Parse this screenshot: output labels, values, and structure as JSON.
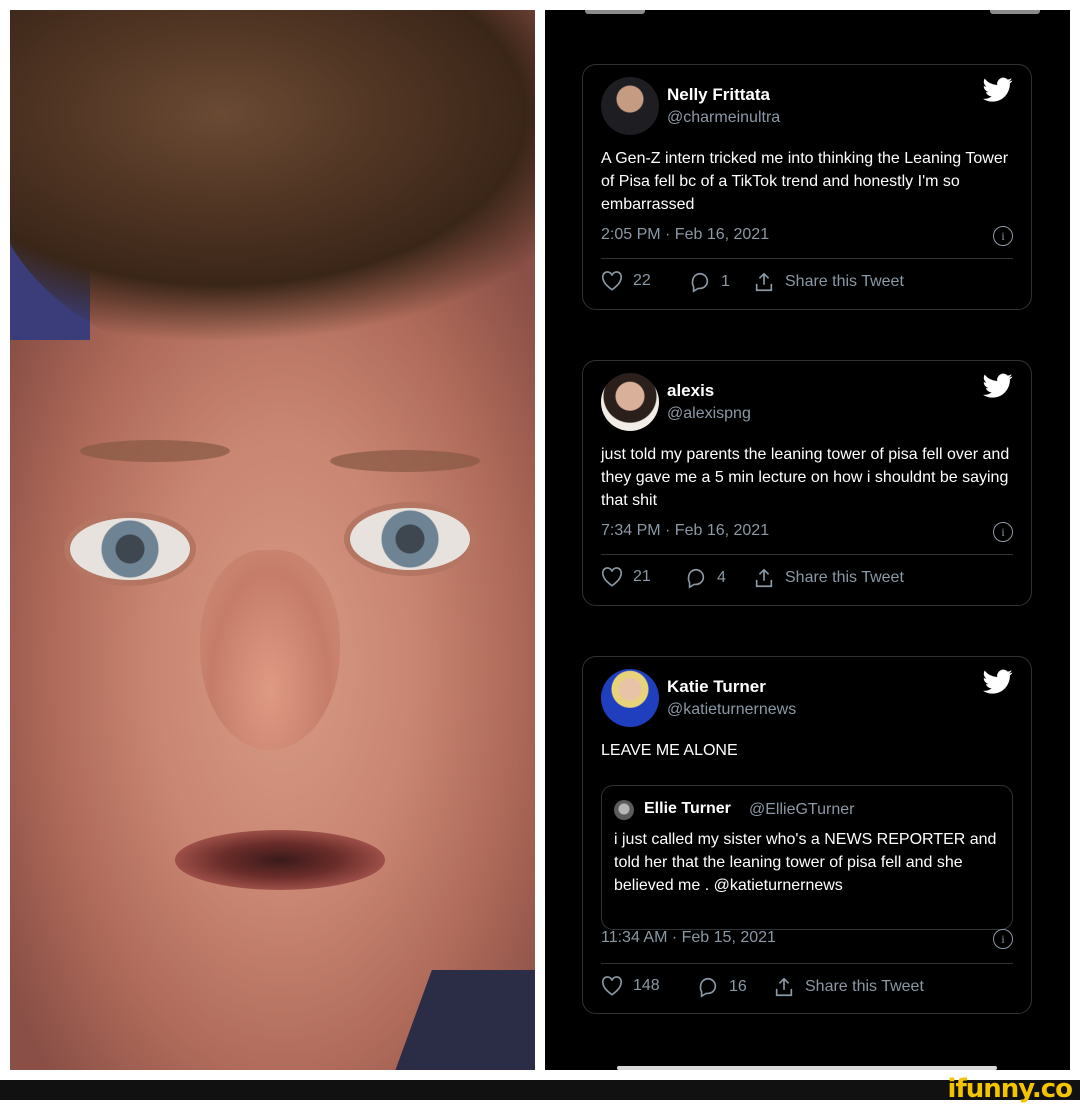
{
  "tweets": [
    {
      "name": "Nelly Frittata",
      "handle": "@charmeinultra",
      "text": "A Gen-Z intern tricked me into thinking the Leaning Tower of Pisa fell bc of a TikTok trend and honestly I'm so embarrassed",
      "timestamp": "2:05 PM · Feb 16, 2021",
      "likes": "22",
      "replies": "1",
      "share_label": "Share this Tweet"
    },
    {
      "name": "alexis",
      "handle": "@alexispng",
      "text": "just told my parents the leaning tower of pisa fell over and they gave me a 5 min lecture on how i shouldnt be saying that shit",
      "timestamp": "7:34 PM · Feb 16, 2021",
      "likes": "21",
      "replies": "4",
      "share_label": "Share this Tweet"
    },
    {
      "name": "Katie Turner",
      "handle": "@katieturnernews",
      "text": "LEAVE ME ALONE",
      "quote": {
        "name": "Ellie Turner",
        "handle": "@EllieGTurner",
        "text": "i just called my sister who's a NEWS REPORTER and told her that the leaning tower of pisa fell and she believed me . @katieturnernews"
      },
      "timestamp": "11:34 AM · Feb 15, 2021",
      "likes": "148",
      "replies": "16",
      "share_label": "Share this Tweet"
    }
  ],
  "icons": {
    "info": "i",
    "bird": "twitter-bird-icon",
    "like": "heart-icon",
    "reply": "speech-bubble-icon",
    "share": "share-icon"
  },
  "watermark": "ifunny.co",
  "colors": {
    "background": "#000000",
    "text": "#ffffff",
    "muted": "#8b98a5",
    "border": "#2f3336",
    "watermark": "#f5c400"
  }
}
